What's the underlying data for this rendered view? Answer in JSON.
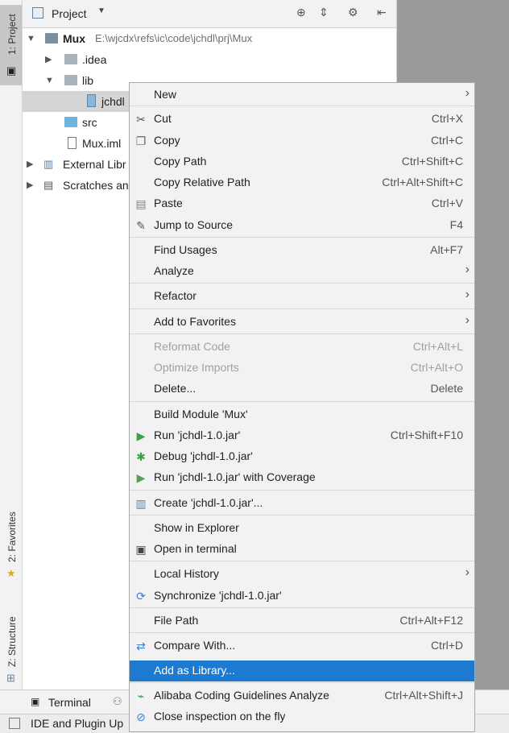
{
  "left_strip": {
    "project_tab": "1: Project",
    "favorites_tab": "2: Favorites",
    "structure_tab": "Z: Structure"
  },
  "panel": {
    "title": "Project",
    "tree": [
      {
        "label": "Mux",
        "path": "E:\\wjcdx\\refs\\ic\\code\\jchdl\\prj\\Mux"
      },
      {
        "label": ".idea"
      },
      {
        "label": "lib"
      },
      {
        "label": "jchdl"
      },
      {
        "label": "src"
      },
      {
        "label": "Mux.iml"
      },
      {
        "label": "External Libr"
      },
      {
        "label": "Scratches an"
      }
    ]
  },
  "bottom": {
    "terminal_tab": "Terminal",
    "status_text": "IDE and Plugin Up"
  },
  "menu": {
    "items": [
      {
        "label": "New",
        "submenu": true
      },
      {
        "label": "Cut",
        "shortcut": "Ctrl+X",
        "icon": "scissors-icon"
      },
      {
        "label": "Copy",
        "shortcut": "Ctrl+C",
        "icon": "copy-icon"
      },
      {
        "label": "Copy Path",
        "shortcut": "Ctrl+Shift+C"
      },
      {
        "label": "Copy Relative Path",
        "shortcut": "Ctrl+Alt+Shift+C"
      },
      {
        "label": "Paste",
        "shortcut": "Ctrl+V",
        "icon": "paste-icon"
      },
      {
        "label": "Jump to Source",
        "shortcut": "F4",
        "icon": "pencil-icon"
      },
      {
        "label": "Find Usages",
        "shortcut": "Alt+F7"
      },
      {
        "label": "Analyze",
        "submenu": true
      },
      {
        "label": "Refactor",
        "submenu": true
      },
      {
        "label": "Add to Favorites",
        "submenu": true
      },
      {
        "label": "Reformat Code",
        "shortcut": "Ctrl+Alt+L",
        "disabled": true
      },
      {
        "label": "Optimize Imports",
        "shortcut": "Ctrl+Alt+O",
        "disabled": true
      },
      {
        "label": "Delete...",
        "shortcut": "Delete"
      },
      {
        "label": "Build Module 'Mux'"
      },
      {
        "label": "Run 'jchdl-1.0.jar'",
        "shortcut": "Ctrl+Shift+F10",
        "icon": "run-icon"
      },
      {
        "label": "Debug 'jchdl-1.0.jar'",
        "icon": "debug-icon"
      },
      {
        "label": "Run 'jchdl-1.0.jar' with Coverage",
        "icon": "coverage-icon"
      },
      {
        "label": "Create 'jchdl-1.0.jar'...",
        "icon": "jar-icon"
      },
      {
        "label": "Show in Explorer"
      },
      {
        "label": "Open in terminal",
        "icon": "terminal-icon"
      },
      {
        "label": "Local History",
        "submenu": true
      },
      {
        "label": "Synchronize 'jchdl-1.0.jar'",
        "icon": "sync-icon"
      },
      {
        "label": "File Path",
        "shortcut": "Ctrl+Alt+F12"
      },
      {
        "label": "Compare With...",
        "shortcut": "Ctrl+D",
        "icon": "compare-icon"
      },
      {
        "label": "Add as Library...",
        "highlighted": true
      },
      {
        "label": "Alibaba Coding Guidelines Analyze",
        "shortcut": "Ctrl+Alt+Shift+J",
        "icon": "analyze-icon"
      },
      {
        "label": "Close inspection on the fly",
        "icon": "no-entry-icon"
      }
    ]
  },
  "colors": {
    "highlight": "#1d7ad1",
    "panel_bg": "#f2f2f2",
    "editor_bg": "#9a9a9a"
  }
}
